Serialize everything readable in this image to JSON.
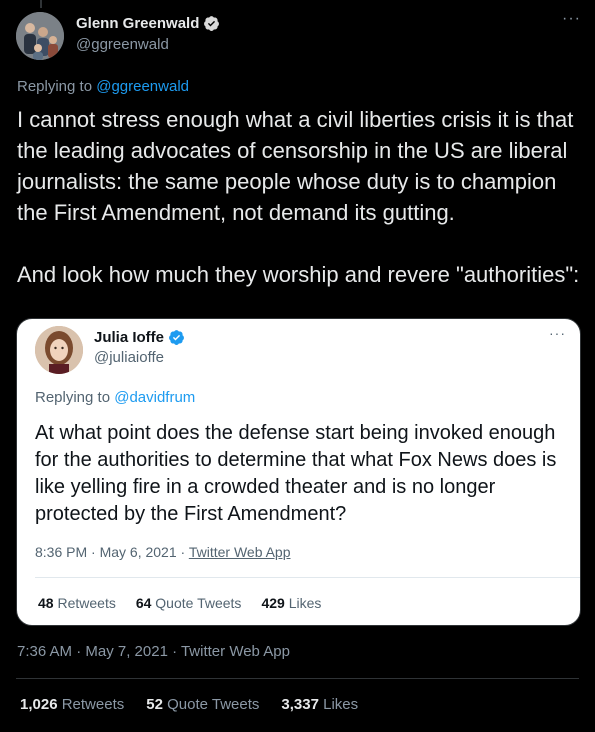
{
  "tweet": {
    "author": {
      "name": "Glenn Greenwald",
      "handle": "@ggreenwald",
      "verified": true
    },
    "replying_label": "Replying to",
    "replying_to": "@ggreenwald",
    "text": "I cannot stress enough what a civil liberties crisis it is that the leading advocates of censorship in the US are liberal journalists: the same people whose duty is to champion the First Amendment, not demand its gutting.\n\nAnd look how much they worship and revere \"authorities\":",
    "meta": "7:36 AM · May 7, 2021 · Twitter Web App",
    "stats": {
      "retweets_count": "1,026",
      "retweets_label": "Retweets",
      "quote_count": "52",
      "quote_label": "Quote Tweets",
      "likes_count": "3,337",
      "likes_label": "Likes"
    },
    "more_icon": "more-dots-icon"
  },
  "quoted": {
    "author": {
      "name": "Julia Ioffe",
      "handle": "@juliaioffe",
      "verified": true
    },
    "replying_label": "Replying to",
    "replying_to": "@davidfrum",
    "text": "At what point does the defense start being invoked enough for the authorities to determine that what Fox News does is like yelling fire in a crowded theater and is no longer protected by the First Amendment?",
    "time": "8:36 PM · May 6, 2021 · ",
    "app": "Twitter Web App",
    "stats": {
      "retweets_count": "48",
      "retweets_label": "Retweets",
      "quote_count": "64",
      "quote_label": "Quote Tweets",
      "likes_count": "429",
      "likes_label": "Likes"
    }
  },
  "colors": {
    "background": "#000000",
    "accent": "#1d9bf0",
    "muted": "#8b98a5",
    "quote_background": "#ffffff"
  }
}
